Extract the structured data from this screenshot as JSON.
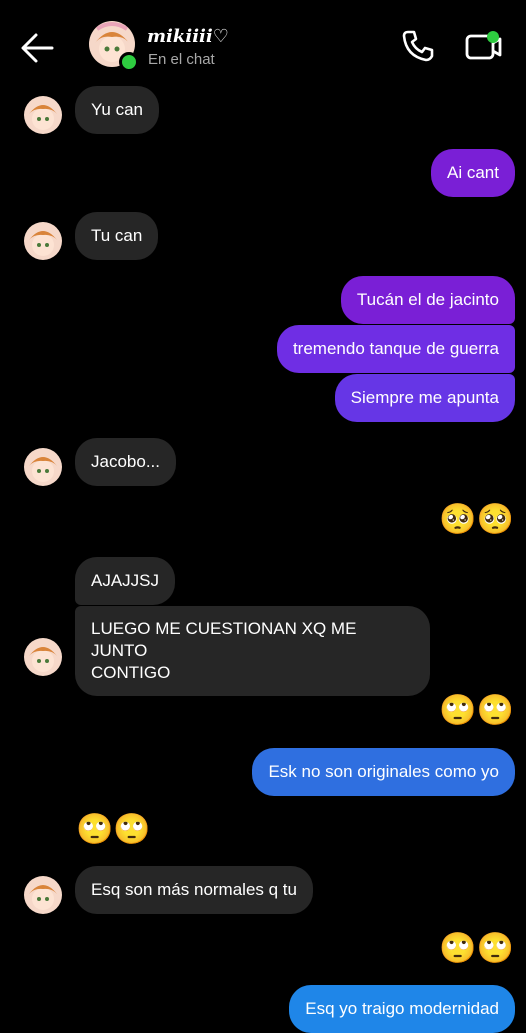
{
  "header": {
    "name": "mikiiii♡",
    "status": "En el chat"
  },
  "messages": [
    {
      "from": "them",
      "text": "Yu can"
    },
    {
      "from": "me",
      "text": "Ai cant"
    },
    {
      "from": "them",
      "text": "Tu can"
    },
    {
      "from": "me",
      "text": "Tucán el de jacinto"
    },
    {
      "from": "me",
      "text": "tremendo tanque de guerra"
    },
    {
      "from": "me",
      "text": "Siempre me apunta"
    },
    {
      "from": "them",
      "text": "Jacobo..."
    },
    {
      "from": "me",
      "text": "🥺🥺"
    },
    {
      "from": "them",
      "text": "AJAJJSJ"
    },
    {
      "from": "them",
      "text": "LUEGO ME CUESTIONAN XQ ME JUNTO\nCONTIGO"
    },
    {
      "from": "me",
      "text": "🙄🙄"
    },
    {
      "from": "me",
      "text": "Esk no son originales como yo"
    },
    {
      "from": "them",
      "text": "🙄🙄"
    },
    {
      "from": "them",
      "text": "Esq son más normales q tu"
    },
    {
      "from": "me",
      "text": "🙄🙄"
    },
    {
      "from": "me",
      "text": "Esq yo traigo modernidad"
    }
  ],
  "icons": [
    "back-arrow-icon",
    "phone-icon",
    "video-call-icon"
  ]
}
